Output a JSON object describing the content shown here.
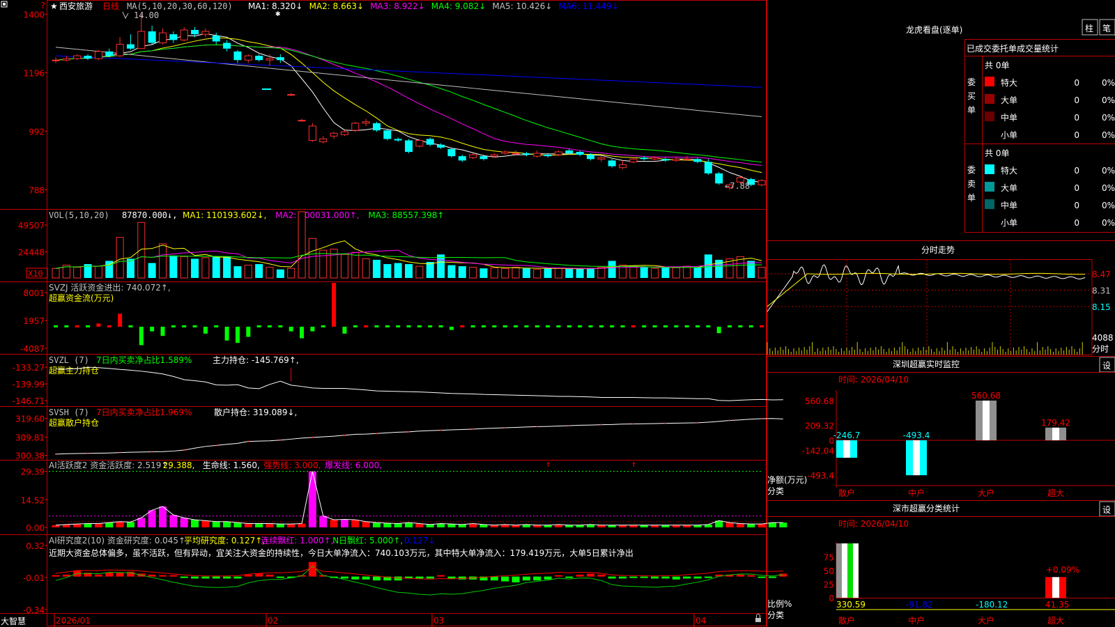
{
  "main": {
    "star": "★",
    "stock_name": "西安旅游",
    "period": "日线",
    "ma_header": "MA(5,10,20,30,60,120)",
    "ma_items": [
      {
        "label": "MA1: 8.320↓",
        "color": "#ffffff"
      },
      {
        "label": "MA2: 8.663↓",
        "color": "#ffff00"
      },
      {
        "label": "MA3: 8.922↓",
        "color": "#ff00ff"
      },
      {
        "label": "MA4: 9.082↓",
        "color": "#00ff00"
      },
      {
        "label": "MA5: 10.426↓",
        "color": "#c0c0c0"
      },
      {
        "label": "MA6: 11.449↓",
        "color": "#0000ff"
      }
    ],
    "y_ticks": [
      "1400",
      "1196",
      "992",
      "788"
    ],
    "high_label": "14.00",
    "low_label": "←7.88"
  },
  "vol": {
    "header": "VOL(5,10,20)",
    "value": "87870.000↓,",
    "items": [
      {
        "label": "MA1: 110193.602↓,",
        "color": "#ffff00"
      },
      {
        "label": "MA2: 100031.000↑,",
        "color": "#ff00ff"
      },
      {
        "label": "MA3: 88557.398↑",
        "color": "#00ff00"
      }
    ],
    "y_ticks": [
      "49507",
      "24448"
    ],
    "x10": "X10"
  },
  "svzj": {
    "header": "SVZJ  活跃资金进出: 740.072↑,",
    "sub": "超赢资金流(万元)",
    "y_ticks": [
      "8001",
      "1957",
      "-4087"
    ]
  },
  "svzl": {
    "header_a": "SVZL (7)",
    "header_b": "7日内买卖净占比1.589%",
    "header_c": "主力持仓: -145.769↑,",
    "sub": "超赢主力持仓",
    "y_ticks": [
      "-133.27",
      "-139.99",
      "-146.71"
    ]
  },
  "svsh": {
    "header_a": "SVSH (7)",
    "header_b": "7日内买卖净占比1.969%",
    "header_c": "散户持仓: 319.089↓,",
    "sub": "超赢散户持仓",
    "y_ticks": [
      "319.60",
      "309.81",
      "300.38"
    ]
  },
  "ai2": {
    "items": [
      {
        "label": "AI活跃度2 资金活跃度: 2.519↑,",
        "color": "#c0c0c0"
      },
      {
        "label": "29.388,",
        "color": "#ffff00"
      },
      {
        "label": "生命线: 1.560,",
        "color": "#ffffff"
      },
      {
        "label": "强势线: 3.000,",
        "color": "#ff0000"
      },
      {
        "label": "爆发线: 6.000,",
        "color": "#ff00ff"
      }
    ],
    "y_ticks": [
      "29.39",
      "14.52",
      "0.00"
    ]
  },
  "airesearch": {
    "items": [
      {
        "label": "AI研究度2(10) 资金研究度: 0.045↑,",
        "color": "#c0c0c0"
      },
      {
        "label": "平均研究度: 0.127↑,",
        "color": "#ffff00"
      },
      {
        "label": "连续飘红: 1.000↑,",
        "color": "#ff00ff"
      },
      {
        "label": "N日飘红: 5.000↑,",
        "color": "#00ff00"
      },
      {
        "label": "0.127↓",
        "color": "#0000ff"
      }
    ],
    "commentary": "近期大资金总体偏多，虽不活跃，但有异动，宜关注大资金的持续性，今日大单净流入：740.103万元，其中特大单净流入：179.419万元，大单5日累计净出",
    "y_ticks": [
      "0.32",
      "-0.01",
      "-0.34"
    ]
  },
  "xaxis": {
    "labels": [
      "2026/01",
      "02",
      "03",
      "04"
    ],
    "logo": "大智慧"
  },
  "right": {
    "dragon_title": "龙虎看盘(逐单)",
    "btn_column": "柱",
    "btn_pen": "笔",
    "stats_header": "已成交委托单成交量统计",
    "buy": {
      "side_label": "委买单",
      "total": "共 0单",
      "rows": [
        {
          "name": "特大",
          "count": "0",
          "pct": "0%",
          "color": "#ff0000"
        },
        {
          "name": "大单",
          "count": "0",
          "pct": "0%",
          "color": "#9a0000"
        },
        {
          "name": "中单",
          "count": "0",
          "pct": "0%",
          "color": "#6a0000"
        },
        {
          "name": "小单",
          "count": "0",
          "pct": "0%",
          "color": ""
        }
      ]
    },
    "sell": {
      "side_label": "委卖单",
      "total": "共 0单",
      "rows": [
        {
          "name": "特大",
          "count": "0",
          "pct": "0%",
          "color": "#00ffff"
        },
        {
          "name": "大单",
          "count": "0",
          "pct": "0%",
          "color": "#009999"
        },
        {
          "name": "中单",
          "count": "0",
          "pct": "0%",
          "color": "#006666"
        },
        {
          "name": "小单",
          "count": "0",
          "pct": "0%",
          "color": ""
        }
      ]
    },
    "intraday": {
      "title": "分时走势",
      "y_ticks": [
        "8.47",
        "8.31",
        "8.15"
      ],
      "vol_tick": "4088",
      "vol_unit": "分时"
    },
    "monitor": {
      "title": "深圳超赢实时监控",
      "setting": "设",
      "time": "时间: 2026/04/10",
      "y_ticks": [
        "560.68",
        "209.32",
        "0",
        "-142.04",
        "-493.4"
      ],
      "unit": "净额(万元)",
      "class_label": "分类"
    },
    "classify": {
      "title": "深市超赢分类统计",
      "setting": "设",
      "time": "时间: 2026/04/10",
      "y_ticks": [
        "75",
        "50",
        "25",
        "0"
      ],
      "unit": "比例%",
      "class_label": "分类"
    }
  },
  "chart_data": [
    {
      "type": "candlestick",
      "title": "西安旅游 日线",
      "ylim": [
        7.5,
        14.3
      ],
      "candles": [
        [
          12.4,
          12.4,
          12.5,
          12.3
        ],
        [
          12.4,
          12.45,
          12.55,
          12.35
        ],
        [
          12.45,
          12.55,
          12.6,
          12.4
        ],
        [
          12.55,
          12.45,
          12.6,
          12.4
        ],
        [
          12.45,
          12.7,
          12.75,
          12.4
        ],
        [
          12.7,
          12.55,
          12.8,
          12.5
        ],
        [
          12.55,
          12.95,
          13.2,
          12.5
        ],
        [
          12.95,
          12.8,
          13.3,
          12.75
        ],
        [
          12.8,
          13.4,
          14.0,
          12.8
        ],
        [
          13.4,
          13.0,
          13.6,
          12.95
        ],
        [
          13.0,
          13.35,
          13.5,
          12.95
        ],
        [
          13.3,
          13.1,
          13.4,
          13.0
        ],
        [
          13.1,
          13.45,
          13.55,
          13.05
        ],
        [
          13.45,
          13.3,
          13.55,
          13.2
        ],
        [
          13.3,
          13.4,
          13.5,
          13.2
        ],
        [
          13.25,
          13.05,
          13.35,
          12.95
        ],
        [
          13.0,
          12.8,
          13.1,
          12.7
        ],
        [
          12.7,
          12.4,
          12.75,
          12.3
        ],
        [
          12.4,
          12.55,
          12.6,
          12.3
        ],
        [
          12.55,
          12.4,
          12.6,
          12.35
        ],
        [
          12.4,
          12.45,
          12.6,
          12.2
        ],
        [
          12.5,
          12.4,
          12.6,
          12.3
        ],
        [
          11.2,
          11.2,
          11.25,
          11.15
        ],
        [
          10.3,
          10.3,
          10.35,
          10.25
        ],
        [
          9.6,
          10.1,
          10.2,
          9.55
        ],
        [
          9.55,
          9.65,
          9.75,
          9.5
        ],
        [
          9.75,
          9.85,
          9.9,
          9.65
        ],
        [
          9.8,
          9.9,
          9.95,
          9.75
        ],
        [
          9.95,
          10.2,
          10.25,
          9.9
        ],
        [
          10.2,
          10.25,
          10.35,
          10.1
        ],
        [
          10.2,
          9.95,
          10.25,
          9.9
        ],
        [
          9.95,
          9.65,
          10.0,
          9.6
        ],
        [
          9.65,
          9.6,
          9.7,
          9.55
        ],
        [
          9.6,
          9.2,
          9.65,
          9.15
        ],
        [
          9.4,
          9.6,
          9.65,
          9.35
        ],
        [
          9.65,
          9.45,
          9.7,
          9.4
        ],
        [
          9.45,
          9.35,
          9.5,
          9.3
        ],
        [
          9.3,
          9.05,
          9.35,
          9.0
        ],
        [
          9.05,
          8.9,
          9.1,
          8.85
        ],
        [
          9.0,
          9.1,
          9.15,
          8.95
        ],
        [
          9.05,
          8.95,
          9.1,
          8.9
        ],
        [
          9.05,
          9.1,
          9.15,
          9.0
        ],
        [
          9.15,
          9.2,
          9.25,
          9.1
        ],
        [
          9.15,
          9.15,
          9.25,
          9.1
        ],
        [
          9.15,
          9.1,
          9.2,
          9.05
        ],
        [
          9.05,
          9.15,
          9.25,
          9.0
        ],
        [
          9.1,
          9.05,
          9.15,
          9.0
        ],
        [
          9.1,
          9.2,
          9.25,
          9.05
        ],
        [
          9.25,
          9.15,
          9.3,
          9.1
        ],
        [
          9.2,
          9.1,
          9.25,
          9.05
        ],
        [
          9.1,
          8.95,
          9.15,
          8.9
        ],
        [
          8.95,
          9.0,
          9.05,
          8.85
        ],
        [
          8.9,
          8.7,
          8.95,
          8.65
        ],
        [
          8.65,
          8.75,
          8.9,
          8.6
        ],
        [
          8.85,
          8.95,
          9.0,
          8.8
        ],
        [
          9.0,
          8.95,
          9.05,
          8.9
        ],
        [
          8.95,
          9.0,
          9.05,
          8.9
        ],
        [
          8.95,
          8.9,
          9.0,
          8.85
        ],
        [
          8.9,
          8.95,
          9.0,
          8.85
        ],
        [
          8.95,
          8.95,
          9.05,
          8.9
        ],
        [
          8.95,
          8.85,
          9.0,
          8.8
        ],
        [
          8.85,
          8.45,
          8.95,
          8.4
        ],
        [
          8.45,
          8.1,
          8.5,
          8.05
        ],
        [
          7.95,
          8.05,
          8.1,
          7.88
        ],
        [
          8.15,
          8.3,
          8.35,
          8.1
        ],
        [
          8.25,
          8.05,
          8.3,
          8.0
        ],
        [
          8.05,
          8.2,
          8.25,
          8.0
        ]
      ]
    },
    {
      "type": "bar",
      "title": "VOL(5,10,20)",
      "ylim": [
        0,
        60000
      ],
      "values": [
        9000,
        12000,
        10000,
        13000,
        11000,
        16000,
        38000,
        18000,
        52000,
        14000,
        32000,
        21000,
        20000,
        18000,
        19000,
        20000,
        20000,
        11000,
        12000,
        13000,
        10000,
        8000,
        9000,
        62000,
        37000,
        26000,
        27000,
        22000,
        24000,
        18000,
        17000,
        13000,
        14000,
        13000,
        11000,
        15000,
        22000,
        12000,
        11000,
        10000,
        9000,
        9500,
        9000,
        10000,
        9000,
        8000,
        9000,
        9000,
        8500,
        8500,
        9000,
        10000,
        16000,
        12000,
        11000,
        10000,
        9000,
        10000,
        9500,
        11000,
        10000,
        22000,
        17000,
        18000,
        20000,
        16000,
        10000
      ]
    },
    {
      "type": "bar",
      "title": "超赢资金流(万元)",
      "ylim": [
        -4087,
        8001
      ],
      "values": [
        -300,
        -300,
        200,
        -300,
        700,
        200,
        2800,
        -200,
        -4000,
        -1000,
        -2000,
        -400,
        -400,
        -500,
        -1500,
        -500,
        -3000,
        -3500,
        -2200,
        -600,
        -400,
        -300,
        -1000,
        -2500,
        -1000,
        -100,
        9500,
        -1500,
        -300,
        600,
        -200,
        -400,
        -300,
        -300,
        -400,
        -200,
        -400,
        -700,
        300,
        -200,
        -300,
        -300,
        -200,
        -400,
        -300,
        -300,
        -300,
        -300,
        -300,
        -200,
        -200,
        -300,
        -200,
        -400,
        200,
        -200,
        -300,
        -200,
        -300,
        -200,
        -300,
        -400,
        -1400,
        -600,
        -300,
        -300,
        200
      ]
    },
    {
      "type": "line",
      "title": "超赢主力持仓",
      "ylim": [
        -147.5,
        -133.0
      ],
      "values": [
        -134.0,
        -134.1,
        -133.9,
        -133.3,
        -133.5,
        -133.8,
        -134.2,
        -134.5,
        -134.9,
        -135.4,
        -136.0,
        -137.0,
        -138.3,
        -138.7,
        -139.2,
        -140.4,
        -140.5,
        -140.3,
        -141.6,
        -141.9,
        -140.2,
        -138.9,
        -140.5,
        -141.0,
        -141.6,
        -141.8,
        -141.8,
        -141.8,
        -142.1,
        -142.4,
        -142.8,
        -142.9,
        -143.0,
        -143.1,
        -143.2,
        -143.4,
        -143.6,
        -143.8,
        -143.9,
        -144.0,
        -144.2,
        -144.3,
        -144.4,
        -144.5,
        -144.6,
        -144.7,
        -144.8,
        -145.0,
        -145.0,
        -145.1,
        -145.2,
        -145.4,
        -145.4,
        -145.4,
        -145.4,
        -145.5,
        -145.6,
        -145.6,
        -145.7,
        -145.8,
        -145.9,
        -145.9,
        -146.6,
        -146.7,
        -146.5,
        -146.3,
        -146.2,
        -146.4,
        -146.3
      ]
    },
    {
      "type": "line",
      "title": "超赢散户持仓",
      "ylim": [
        299.5,
        320.5
      ],
      "values": [
        301.0,
        301.2,
        301.3,
        301.4,
        301.5,
        301.6,
        301.8,
        302.0,
        302.1,
        302.2,
        302.3,
        302.6,
        303.1,
        304.1,
        305.0,
        305.5,
        306.1,
        306.6,
        307.6,
        307.8,
        307.9,
        308.3,
        308.8,
        309.3,
        309.7,
        310.0,
        310.3,
        310.8,
        311.3,
        311.4,
        311.7,
        312.1,
        312.4,
        312.6,
        313.0,
        313.2,
        313.4,
        313.6,
        313.8,
        314.0,
        314.3,
        314.5,
        314.7,
        314.9,
        315.1,
        315.3,
        315.4,
        315.6,
        315.8,
        316.0,
        316.1,
        316.3,
        316.4,
        316.6,
        316.7,
        316.8,
        316.9,
        317.0,
        317.1,
        317.2,
        317.3,
        317.6,
        318.0,
        318.5,
        318.8,
        319.2,
        319.4,
        319.5,
        319.3
      ]
    },
    {
      "type": "bar",
      "title": "AI活跃度2",
      "ylim": [
        0,
        30
      ],
      "values": [
        1.2,
        1.5,
        1.8,
        2.0,
        2.0,
        2.5,
        3.0,
        2.8,
        5.0,
        9.0,
        11.0,
        6.5,
        5.0,
        4.0,
        3.5,
        3.0,
        3.0,
        2.5,
        2.0,
        2.0,
        2.0,
        1.8,
        1.8,
        2.0,
        29.4,
        6.0,
        4.0,
        4.2,
        4.0,
        3.0,
        2.5,
        2.2,
        2.0,
        2.5,
        2.0,
        1.5,
        2.0,
        1.8,
        1.5,
        2.0,
        1.5,
        1.2,
        1.5,
        1.2,
        1.5,
        1.2,
        1.2,
        1.5,
        1.2,
        1.2,
        1.5,
        1.2,
        1.2,
        1.2,
        1.2,
        1.2,
        1.2,
        1.2,
        1.2,
        1.2,
        1.2,
        1.5,
        3.5,
        2.5,
        2.0,
        1.8,
        1.8,
        2.5,
        2.5
      ],
      "reference_lines": [
        1.56,
        3.0,
        6.0
      ]
    },
    {
      "type": "bar",
      "title": "AI研究度2(10)",
      "ylim": [
        -0.34,
        0.32
      ],
      "values": [
        0.0,
        0.02,
        0.06,
        0.04,
        0.02,
        0.04,
        0.04,
        0.05,
        0.03,
        0.02,
        0.01,
        0.0,
        -0.01,
        -0.02,
        -0.02,
        -0.02,
        -0.02,
        -0.02,
        0.02,
        0.03,
        0.02,
        -0.01,
        -0.01,
        0.0,
        0.15,
        0.0,
        -0.01,
        -0.02,
        -0.03,
        -0.03,
        -0.04,
        -0.04,
        -0.04,
        -0.02,
        -0.02,
        -0.02,
        0.0,
        -0.02,
        -0.03,
        -0.03,
        -0.04,
        -0.04,
        -0.05,
        -0.06,
        -0.04,
        -0.04,
        -0.03,
        0.0,
        -0.01,
        0.02,
        0.03,
        0.02,
        -0.02,
        -0.02,
        -0.01,
        -0.01,
        -0.02,
        -0.02,
        -0.03,
        -0.02,
        -0.02,
        -0.01,
        0.02,
        0.02,
        0.02,
        0.01,
        -0.01,
        -0.01,
        0.03
      ]
    },
    {
      "type": "bar",
      "title": "深圳超赢实时监控",
      "categories": [
        "散户",
        "中户",
        "大户",
        "超大"
      ],
      "values": [
        -246.7,
        -493.4,
        560.68,
        179.42
      ],
      "ylim": [
        -493.4,
        560.68
      ]
    },
    {
      "type": "bar",
      "title": "深市超赢分类统计",
      "categories": [
        "散户",
        "中户",
        "大户",
        "超大"
      ],
      "values": [
        330.59,
        -91.82,
        -180.12,
        41.35
      ],
      "ylim": [
        0,
        100
      ],
      "annotation": "+0.09%"
    }
  ]
}
